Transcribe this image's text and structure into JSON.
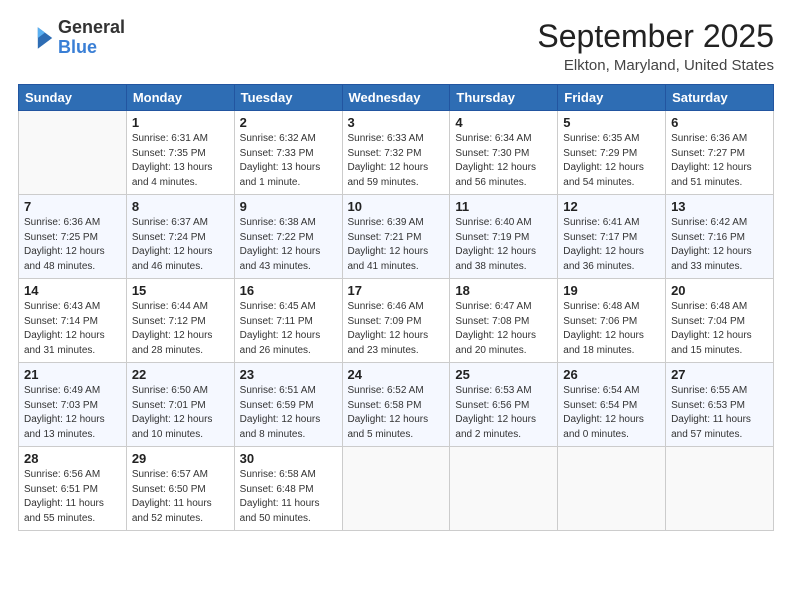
{
  "logo": {
    "general": "General",
    "blue": "Blue"
  },
  "header": {
    "month": "September 2025",
    "location": "Elkton, Maryland, United States"
  },
  "weekdays": [
    "Sunday",
    "Monday",
    "Tuesday",
    "Wednesday",
    "Thursday",
    "Friday",
    "Saturday"
  ],
  "weeks": [
    [
      {
        "day": "",
        "info": ""
      },
      {
        "day": "1",
        "info": "Sunrise: 6:31 AM\nSunset: 7:35 PM\nDaylight: 13 hours\nand 4 minutes."
      },
      {
        "day": "2",
        "info": "Sunrise: 6:32 AM\nSunset: 7:33 PM\nDaylight: 13 hours\nand 1 minute."
      },
      {
        "day": "3",
        "info": "Sunrise: 6:33 AM\nSunset: 7:32 PM\nDaylight: 12 hours\nand 59 minutes."
      },
      {
        "day": "4",
        "info": "Sunrise: 6:34 AM\nSunset: 7:30 PM\nDaylight: 12 hours\nand 56 minutes."
      },
      {
        "day": "5",
        "info": "Sunrise: 6:35 AM\nSunset: 7:29 PM\nDaylight: 12 hours\nand 54 minutes."
      },
      {
        "day": "6",
        "info": "Sunrise: 6:36 AM\nSunset: 7:27 PM\nDaylight: 12 hours\nand 51 minutes."
      }
    ],
    [
      {
        "day": "7",
        "info": "Sunrise: 6:36 AM\nSunset: 7:25 PM\nDaylight: 12 hours\nand 48 minutes."
      },
      {
        "day": "8",
        "info": "Sunrise: 6:37 AM\nSunset: 7:24 PM\nDaylight: 12 hours\nand 46 minutes."
      },
      {
        "day": "9",
        "info": "Sunrise: 6:38 AM\nSunset: 7:22 PM\nDaylight: 12 hours\nand 43 minutes."
      },
      {
        "day": "10",
        "info": "Sunrise: 6:39 AM\nSunset: 7:21 PM\nDaylight: 12 hours\nand 41 minutes."
      },
      {
        "day": "11",
        "info": "Sunrise: 6:40 AM\nSunset: 7:19 PM\nDaylight: 12 hours\nand 38 minutes."
      },
      {
        "day": "12",
        "info": "Sunrise: 6:41 AM\nSunset: 7:17 PM\nDaylight: 12 hours\nand 36 minutes."
      },
      {
        "day": "13",
        "info": "Sunrise: 6:42 AM\nSunset: 7:16 PM\nDaylight: 12 hours\nand 33 minutes."
      }
    ],
    [
      {
        "day": "14",
        "info": "Sunrise: 6:43 AM\nSunset: 7:14 PM\nDaylight: 12 hours\nand 31 minutes."
      },
      {
        "day": "15",
        "info": "Sunrise: 6:44 AM\nSunset: 7:12 PM\nDaylight: 12 hours\nand 28 minutes."
      },
      {
        "day": "16",
        "info": "Sunrise: 6:45 AM\nSunset: 7:11 PM\nDaylight: 12 hours\nand 26 minutes."
      },
      {
        "day": "17",
        "info": "Sunrise: 6:46 AM\nSunset: 7:09 PM\nDaylight: 12 hours\nand 23 minutes."
      },
      {
        "day": "18",
        "info": "Sunrise: 6:47 AM\nSunset: 7:08 PM\nDaylight: 12 hours\nand 20 minutes."
      },
      {
        "day": "19",
        "info": "Sunrise: 6:48 AM\nSunset: 7:06 PM\nDaylight: 12 hours\nand 18 minutes."
      },
      {
        "day": "20",
        "info": "Sunrise: 6:48 AM\nSunset: 7:04 PM\nDaylight: 12 hours\nand 15 minutes."
      }
    ],
    [
      {
        "day": "21",
        "info": "Sunrise: 6:49 AM\nSunset: 7:03 PM\nDaylight: 12 hours\nand 13 minutes."
      },
      {
        "day": "22",
        "info": "Sunrise: 6:50 AM\nSunset: 7:01 PM\nDaylight: 12 hours\nand 10 minutes."
      },
      {
        "day": "23",
        "info": "Sunrise: 6:51 AM\nSunset: 6:59 PM\nDaylight: 12 hours\nand 8 minutes."
      },
      {
        "day": "24",
        "info": "Sunrise: 6:52 AM\nSunset: 6:58 PM\nDaylight: 12 hours\nand 5 minutes."
      },
      {
        "day": "25",
        "info": "Sunrise: 6:53 AM\nSunset: 6:56 PM\nDaylight: 12 hours\nand 2 minutes."
      },
      {
        "day": "26",
        "info": "Sunrise: 6:54 AM\nSunset: 6:54 PM\nDaylight: 12 hours\nand 0 minutes."
      },
      {
        "day": "27",
        "info": "Sunrise: 6:55 AM\nSunset: 6:53 PM\nDaylight: 11 hours\nand 57 minutes."
      }
    ],
    [
      {
        "day": "28",
        "info": "Sunrise: 6:56 AM\nSunset: 6:51 PM\nDaylight: 11 hours\nand 55 minutes."
      },
      {
        "day": "29",
        "info": "Sunrise: 6:57 AM\nSunset: 6:50 PM\nDaylight: 11 hours\nand 52 minutes."
      },
      {
        "day": "30",
        "info": "Sunrise: 6:58 AM\nSunset: 6:48 PM\nDaylight: 11 hours\nand 50 minutes."
      },
      {
        "day": "",
        "info": ""
      },
      {
        "day": "",
        "info": ""
      },
      {
        "day": "",
        "info": ""
      },
      {
        "day": "",
        "info": ""
      }
    ]
  ]
}
